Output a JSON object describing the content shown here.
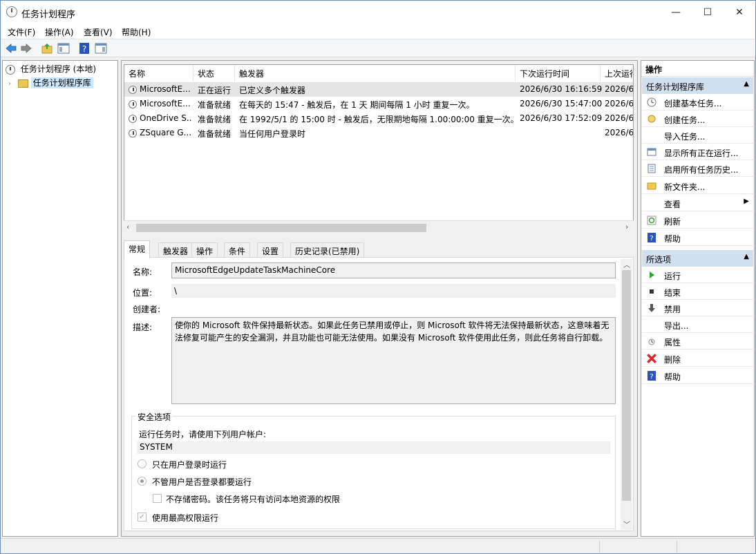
{
  "window": {
    "title": "任务计划程序",
    "minimize": "—",
    "maximize": "☐",
    "close": "✕"
  },
  "menu": [
    "文件(F)",
    "操作(A)",
    "查看(V)",
    "帮助(H)"
  ],
  "tree": {
    "root": "任务计划程序 (本地)",
    "child": "任务计划程序库"
  },
  "list": {
    "columns": [
      "名称",
      "状态",
      "触发器",
      "下次运行时间",
      "上次运行"
    ],
    "rows": [
      {
        "name": "MicrosoftE...",
        "status": "正在运行",
        "trigger": "已定义多个触发器",
        "next": "2026/6/30 16:16:59",
        "last": "2026/6/"
      },
      {
        "name": "MicrosoftE...",
        "status": "准备就绪",
        "trigger": "在每天的 15:47 - 触发后，在 1 天 期间每隔 1 小时 重复一次。",
        "next": "2026/6/30 15:47:00",
        "last": "2026/6/"
      },
      {
        "name": "OneDrive S...",
        "status": "准备就绪",
        "trigger": "在 1992/5/1 的 15:00 时 - 触发后，无限期地每隔 1.00:00:00 重复一次。",
        "next": "2026/6/30 17:52:09",
        "last": "2026/6/"
      },
      {
        "name": "ZSquare G...",
        "status": "准备就绪",
        "trigger": "当任何用户登录时",
        "next": "",
        "last": "2026/6/"
      }
    ]
  },
  "tabs": [
    "常规",
    "触发器",
    "操作",
    "条件",
    "设置",
    "历史记录(已禁用)"
  ],
  "general": {
    "name_label": "名称:",
    "name_value": "MicrosoftEdgeUpdateTaskMachineCore",
    "location_label": "位置:",
    "location_value": "\\",
    "author_label": "创建者:",
    "desc_label": "描述:",
    "desc_value": "使你的 Microsoft 软件保持最新状态。如果此任务已禁用或停止，则 Microsoft 软件将无法保持最新状态，这意味着无法修复可能产生的安全漏洞，并且功能也可能无法使用。如果没有 Microsoft 软件使用此任务，则此任务将自行卸载。",
    "security_title": "安全选项",
    "run_as_label": "运行任务时，请使用下列用户帐户:",
    "account": "SYSTEM",
    "radio_logged_on": "只在用户登录时运行",
    "radio_whether": "不管用户是否登录都要运行",
    "no_store_pw": "不存储密码。该任务将只有访问本地资源的权限",
    "highest": "使用最高权限运行"
  },
  "actions": {
    "header": "操作",
    "section1": "任务计划程序库",
    "items1": [
      "创建基本任务...",
      "创建任务...",
      "导入任务...",
      "显示所有正在运行...",
      "启用所有任务历史...",
      "新文件夹...",
      "查看",
      "刷新",
      "帮助"
    ],
    "section2": "所选项",
    "items2": [
      "运行",
      "结束",
      "禁用",
      "导出...",
      "属性",
      "删除",
      "帮助"
    ]
  },
  "colors": {
    "selection": "#cce8ff",
    "section_bg": "#d1e0ef",
    "accent": "#0078d7"
  }
}
